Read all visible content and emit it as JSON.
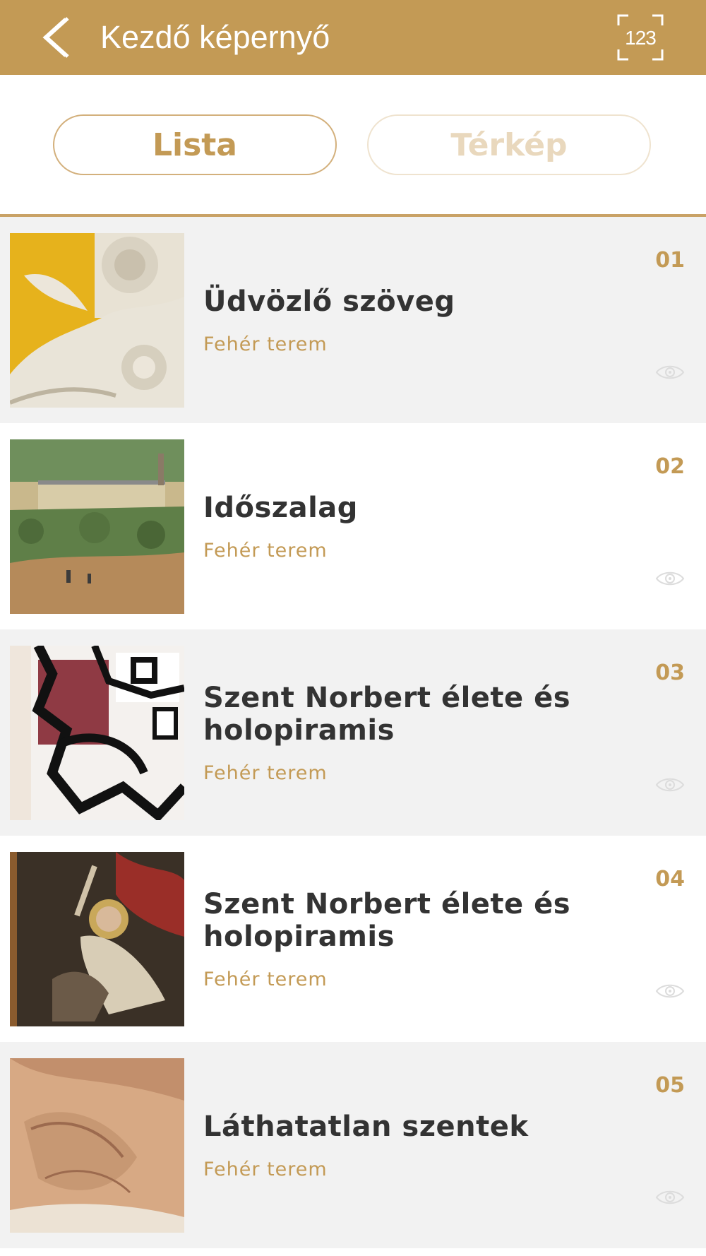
{
  "header": {
    "title": "Kezdő képernyő",
    "back_icon": "chevron-left-icon",
    "numpad_icon": "number-entry-icon",
    "numpad_label": "123"
  },
  "segments": [
    {
      "label": "Lista",
      "active": true
    },
    {
      "label": "Térkép",
      "active": false
    }
  ],
  "items": [
    {
      "number": "01",
      "title": "Üdvözlő szöveg",
      "subtitle": "Fehér terem",
      "thumb": "stucco-ornament"
    },
    {
      "number": "02",
      "title": "Időszalag",
      "subtitle": "Fehér terem",
      "thumb": "landscape-painting"
    },
    {
      "number": "03",
      "title": "Szent Norbert élete és holopiramis",
      "subtitle": "Fehér terem",
      "thumb": "stained-glass"
    },
    {
      "number": "04",
      "title": "Szent Norbert élete és holopiramis",
      "subtitle": "Fehér terem",
      "thumb": "saint-painting"
    },
    {
      "number": "05",
      "title": "Láthatatlan szentek",
      "subtitle": "Fehér terem",
      "thumb": "fresco-detail"
    }
  ],
  "colors": {
    "accent": "#c39a55",
    "row_shade": "#f2f2f2",
    "title_text": "#333333"
  }
}
